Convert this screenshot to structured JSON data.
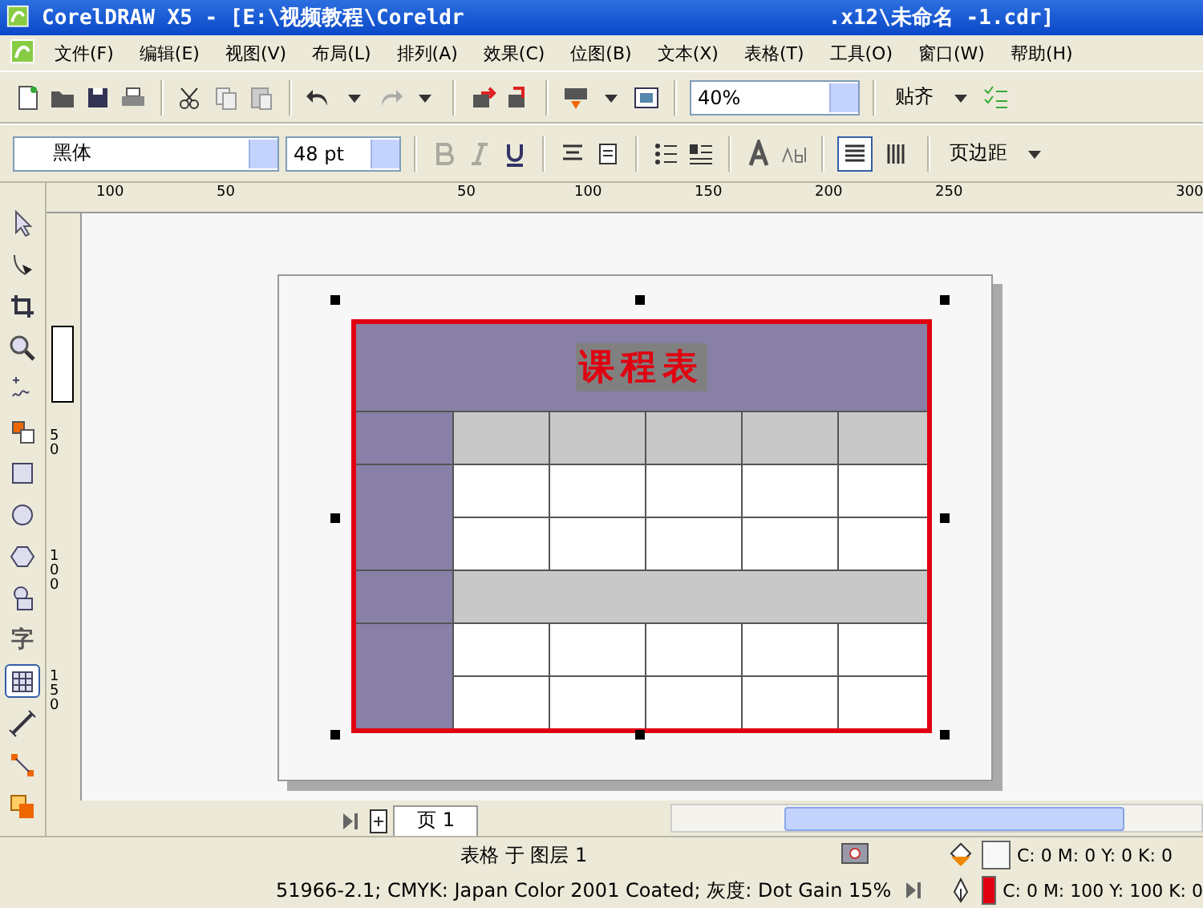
{
  "window": {
    "title_start": "CorelDRAW X5 - [E:\\视频教程\\Coreldr",
    "title_end": ".x12\\未命名 -1.cdr]"
  },
  "menu": [
    "文件(F)",
    "编辑(E)",
    "视图(V)",
    "布局(L)",
    "排列(A)",
    "效果(C)",
    "位图(B)",
    "文本(X)",
    "表格(T)",
    "工具(O)",
    "窗口(W)",
    "帮助(H)"
  ],
  "standard_toolbar": {
    "zoom": "40%",
    "snap": "贴齐"
  },
  "property_bar": {
    "font": "黑体",
    "size": "48 pt",
    "bold_disabled": true,
    "italic_disabled": true,
    "text_direction": [
      {
        "selected": true
      },
      {
        "selected": false
      }
    ],
    "margins": "页边距"
  },
  "toolbox": [
    {
      "kind": "icon",
      "selected": false
    },
    {
      "kind": "icon",
      "selected": false
    },
    {
      "kind": "icon",
      "selected": false
    },
    {
      "kind": "icon",
      "selected": false
    },
    {
      "kind": "icon",
      "selected": false
    },
    {
      "kind": "icon",
      "selected": false
    },
    {
      "kind": "icon",
      "selected": false
    },
    {
      "kind": "icon",
      "selected": false
    },
    {
      "kind": "icon",
      "selected": false
    },
    {
      "kind": "icon",
      "selected": false
    },
    {
      "kind": "glyph",
      "text": "字",
      "selected": false
    },
    {
      "kind": "icon",
      "selected": true
    },
    {
      "kind": "icon",
      "selected": false
    },
    {
      "kind": "icon",
      "selected": false
    },
    {
      "kind": "icon",
      "selected": false
    }
  ],
  "rulers": {
    "horizontal": [
      "100",
      "50",
      "50",
      "100",
      "150",
      "200",
      "250",
      "300"
    ],
    "vertical": [
      "50",
      "100",
      "150"
    ]
  },
  "table": {
    "rows": [
      {
        "kind": "title",
        "text": "课程表",
        "text_selected": true
      },
      {
        "kind": "header"
      },
      {
        "kind": "body"
      },
      {
        "kind": "body"
      },
      {
        "kind": "break"
      },
      {
        "kind": "body"
      },
      {
        "kind": "body"
      }
    ]
  },
  "page_tabs": [
    {
      "label": "页 1",
      "selected": true
    }
  ],
  "status_bar": {
    "selection": "表格 于 图层 1",
    "color_profile": "51966-2.1; CMYK: Japan Color 2001 Coated; 灰度: Dot Gain 15%",
    "fill": {
      "color": "#f8f8f8",
      "text": "C: 0 M: 0 Y: 0 K: 0"
    },
    "outline": {
      "color": "#e00010",
      "text": "C: 0 M: 100 Y: 100 K: 0"
    }
  }
}
